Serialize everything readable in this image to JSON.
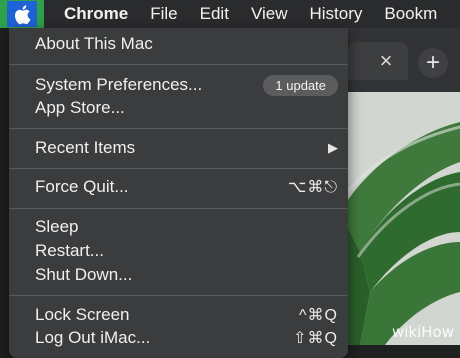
{
  "menubar": {
    "app_name": "Chrome",
    "items": [
      "File",
      "Edit",
      "View",
      "History",
      "Bookm"
    ],
    "highlight_color": "#2ea24a",
    "apple_icon": "apple-icon"
  },
  "browser": {
    "tab_close": "×",
    "new_tab": "+"
  },
  "apple_menu": {
    "about": "About This Mac",
    "system_preferences": "System Preferences...",
    "update_badge": "1 update",
    "app_store": "App Store...",
    "recent_items": "Recent Items",
    "recent_arrow": "▶",
    "force_quit": "Force Quit...",
    "force_quit_shortcut": "⌥⌘⎋",
    "sleep": "Sleep",
    "restart": "Restart...",
    "shut_down": "Shut Down...",
    "lock_screen": "Lock Screen",
    "lock_screen_shortcut": "^⌘Q",
    "log_out": "Log Out iMac...",
    "log_out_shortcut": "⇧⌘Q"
  },
  "watermark": "wikiHow"
}
